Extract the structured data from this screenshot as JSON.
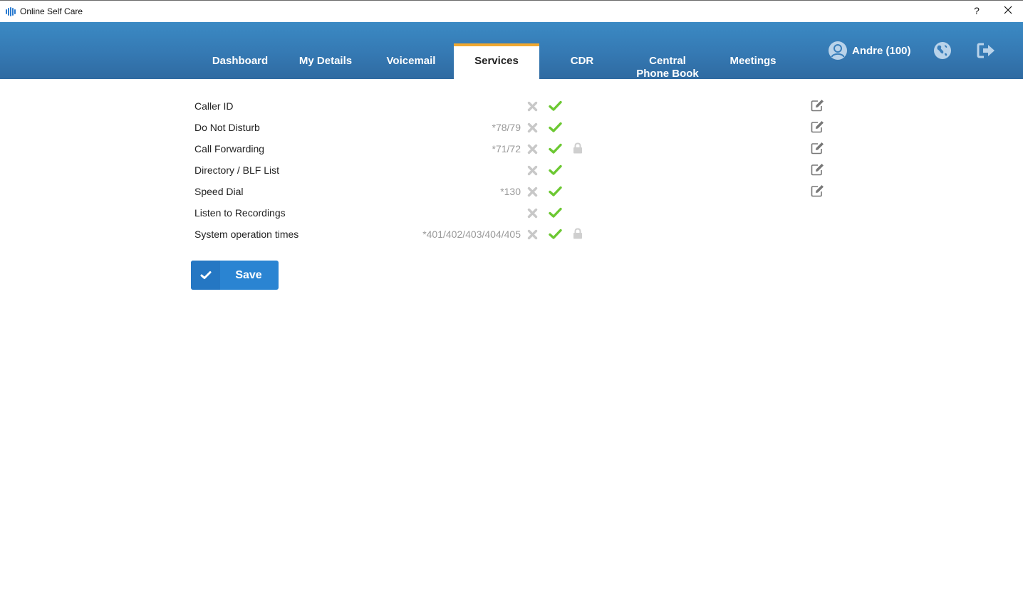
{
  "window": {
    "title": "Online Self Care",
    "help_label": "?",
    "close_icon": "close-icon"
  },
  "header": {
    "tabs": [
      {
        "label": "Dashboard",
        "active": false
      },
      {
        "label": "My Details",
        "active": false
      },
      {
        "label": "Voicemail",
        "active": false
      },
      {
        "label": "Services",
        "active": true
      },
      {
        "label": "CDR",
        "active": false
      },
      {
        "label": "Central Phone Book",
        "active": false
      },
      {
        "label": "Meetings",
        "active": false
      }
    ],
    "user": {
      "name": "Andre (100)",
      "icon": "user-avatar-icon"
    },
    "language_icon": "globe-icon",
    "logout_icon": "logout-icon",
    "accent_color": "#f0a830",
    "bar_color": "#3579b3"
  },
  "services": {
    "rows": [
      {
        "label": "Caller ID",
        "code": "",
        "locked": false,
        "editable": true
      },
      {
        "label": "Do Not Disturb",
        "code": "*78/79",
        "locked": false,
        "editable": true
      },
      {
        "label": "Call Forwarding",
        "code": "*71/72",
        "locked": true,
        "editable": true
      },
      {
        "label": "Directory / BLF List",
        "code": "",
        "locked": false,
        "editable": true
      },
      {
        "label": "Speed Dial",
        "code": "*130",
        "locked": false,
        "editable": true
      },
      {
        "label": "Listen to Recordings",
        "code": "",
        "locked": false,
        "editable": false
      },
      {
        "label": "System operation times",
        "code": "*401/402/403/404/405",
        "locked": true,
        "editable": false
      }
    ],
    "status_colors": {
      "enabled": "#6cc832",
      "disabled": "#c8c8c8"
    }
  },
  "save_button": {
    "label": "Save",
    "icon": "check-icon",
    "color": "#2a84d2"
  }
}
